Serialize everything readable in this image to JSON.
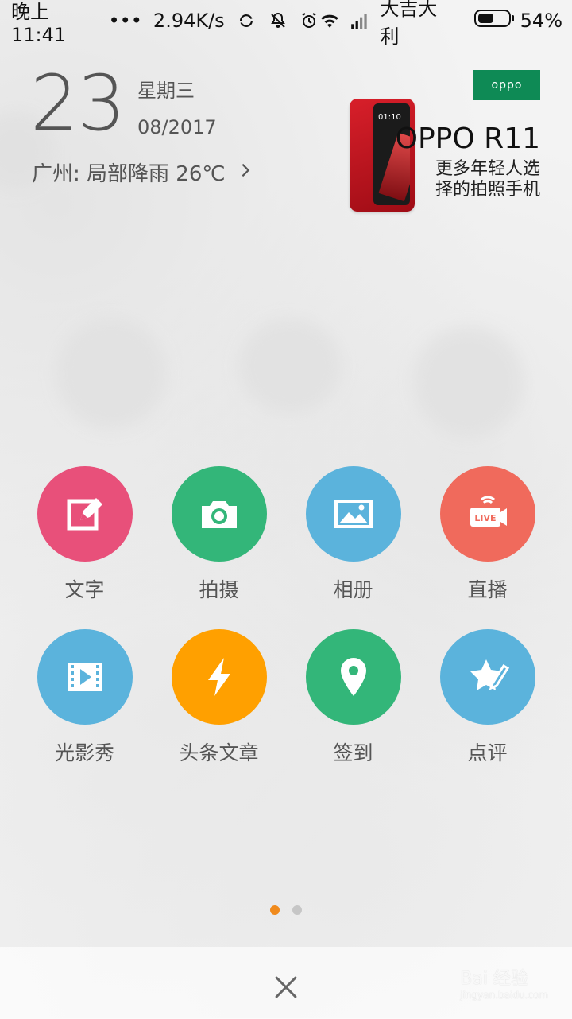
{
  "status_bar": {
    "time": "晚上11:41",
    "dots": "•••",
    "net_speed": "2.94K/s",
    "carrier": "大吉大利",
    "battery_percent": "54%",
    "battery_level": 0.54,
    "icons": [
      "sync-icon",
      "mute-icon",
      "alarm-icon",
      "wifi-icon",
      "signal-icon",
      "battery-icon"
    ]
  },
  "date_widget": {
    "day": "23",
    "weekday": "星期三",
    "month_year": "08/2017",
    "weather": "广州: 局部降雨 26℃"
  },
  "ad": {
    "brand_logo": "oppo",
    "phone_screen_time": "01:10",
    "title": "OPPO R11",
    "description": "更多年轻人选择的拍照手机"
  },
  "actions": [
    {
      "label": "文字",
      "icon": "edit-icon",
      "color": "#e8507a"
    },
    {
      "label": "拍摄",
      "icon": "camera-icon",
      "color": "#33b679"
    },
    {
      "label": "相册",
      "icon": "album-icon",
      "color": "#5bb3dc"
    },
    {
      "label": "直播",
      "icon": "live-icon",
      "color": "#f06a5c"
    },
    {
      "label": "光影秀",
      "icon": "video-icon",
      "color": "#5bb3dc"
    },
    {
      "label": "头条文章",
      "icon": "lightning-icon",
      "color": "#ffa000"
    },
    {
      "label": "签到",
      "icon": "location-icon",
      "color": "#33b679"
    },
    {
      "label": "点评",
      "icon": "review-icon",
      "color": "#5bb3dc"
    }
  ],
  "live_badge": "LIVE",
  "pagination": {
    "current": 1,
    "total": 2
  },
  "watermark": {
    "logo": "Bai 经验",
    "url": "jingyan.baidu.com"
  }
}
